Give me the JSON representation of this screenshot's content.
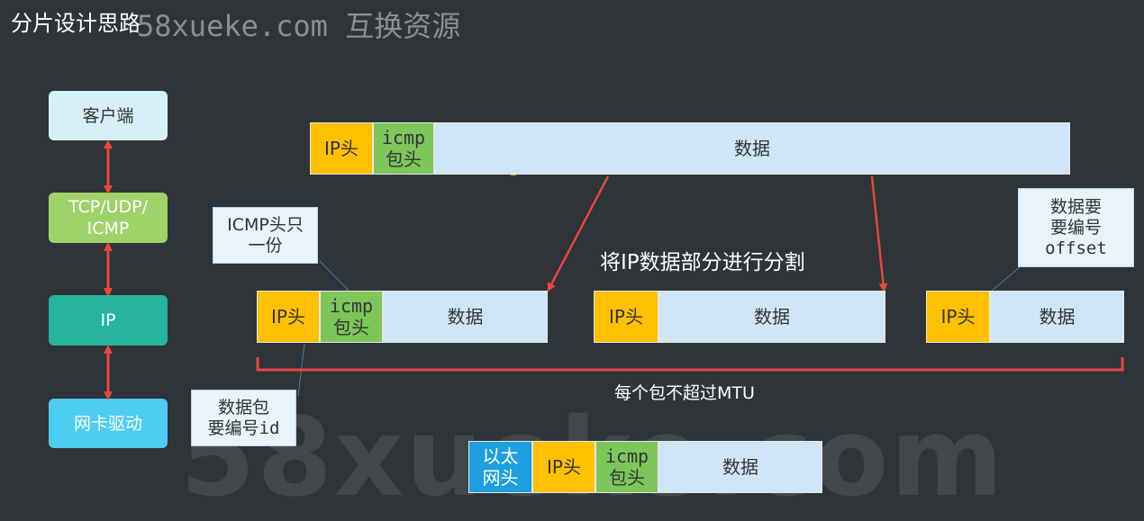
{
  "title": "分片设计思路",
  "watermark_top": "58xueke.com 互换资源",
  "watermark_big": "58xueke.com",
  "stack": {
    "client": "客户端",
    "tcp_line1": "TCP/UDP/",
    "tcp_line2": "ICMP",
    "ip": "IP",
    "nic": "网卡驱动"
  },
  "packet": {
    "ip_head": "IP头",
    "icmp_line1": "icmp",
    "icmp_line2": "包头",
    "data": "数据"
  },
  "frame": {
    "eth_line1": "以太",
    "eth_line2": "网头"
  },
  "notes": {
    "icmp_once_line1": "ICMP头只",
    "icmp_once_line2": "一份",
    "offset_line1": "数据要",
    "offset_line2": "要编号",
    "offset_line3": "offset",
    "id_line1": "数据包",
    "id_line2": "要编号id"
  },
  "split_label": "将IP数据部分进行分割",
  "mtu_label": "每个包不超过MTU",
  "colors": {
    "background": "#2f3438",
    "ip_head": "#ffc000",
    "icmp_head": "#7dc65a",
    "data": "#cfe5fa",
    "ethernet": "#1d9fe0",
    "arrow": "#e8473e"
  }
}
